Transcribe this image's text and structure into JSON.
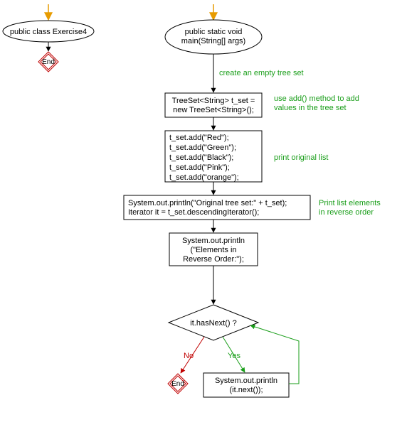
{
  "chart_data": {
    "type": "flowchart",
    "lanes": [
      {
        "name": "class",
        "nodes": [
          {
            "id": "class_entry",
            "type": "entry"
          },
          {
            "id": "class_ellipse",
            "type": "terminator",
            "text": "public class Exercise4"
          },
          {
            "id": "class_end",
            "type": "end",
            "text": "End"
          }
        ],
        "edges": [
          {
            "from": "class_entry",
            "to": "class_ellipse"
          },
          {
            "from": "class_ellipse",
            "to": "class_end"
          }
        ]
      },
      {
        "name": "main",
        "nodes": [
          {
            "id": "main_entry",
            "type": "entry"
          },
          {
            "id": "main_ellipse",
            "type": "terminator",
            "text_lines": [
              "public static void",
              "main(String[] args)"
            ]
          },
          {
            "id": "c1",
            "type": "comment",
            "text": "create an empty tree set"
          },
          {
            "id": "b1",
            "type": "process",
            "text_lines": [
              "TreeSet<String> t_set =",
              "new TreeSet<String>();"
            ]
          },
          {
            "id": "c2",
            "type": "comment",
            "text_lines": [
              "use add() method to add",
              "values in the tree set"
            ]
          },
          {
            "id": "b2",
            "type": "process",
            "text_lines": [
              "t_set.add(\"Red\");",
              "t_set.add(\"Green\");",
              "t_set.add(\"Black\");",
              "t_set.add(\"Pink\");",
              "t_set.add(\"orange\");"
            ]
          },
          {
            "id": "c3",
            "type": "comment",
            "text": "print original list"
          },
          {
            "id": "b3",
            "type": "process",
            "text_lines": [
              "System.out.println(\"Original tree set:\" + t_set);",
              "Iterator it = t_set.descendingIterator();"
            ]
          },
          {
            "id": "c4",
            "type": "comment",
            "text_lines": [
              "Print list elements",
              "in reverse order"
            ]
          },
          {
            "id": "b4",
            "type": "process",
            "text_lines": [
              "System.out.println",
              "(\"Elements in",
              "Reverse Order:\");"
            ]
          },
          {
            "id": "d1",
            "type": "decision",
            "text": "it.hasNext() ?"
          },
          {
            "id": "main_end",
            "type": "end",
            "text": "End"
          },
          {
            "id": "b5",
            "type": "process",
            "text_lines": [
              "System.out.println",
              "(it.next());"
            ]
          }
        ],
        "edges": [
          {
            "from": "main_entry",
            "to": "main_ellipse"
          },
          {
            "from": "main_ellipse",
            "to": "b1",
            "via_comment": "c1"
          },
          {
            "from": "b1",
            "to": "b2",
            "side_comment": "c2"
          },
          {
            "from": "b2",
            "to": "b3",
            "side_comment": "c3"
          },
          {
            "from": "b3",
            "to": "b4",
            "side_comment": "c4"
          },
          {
            "from": "b4",
            "to": "d1"
          },
          {
            "from": "d1",
            "to": "main_end",
            "label": "No"
          },
          {
            "from": "d1",
            "to": "b5",
            "label": "Yes"
          },
          {
            "from": "b5",
            "to": "d1"
          }
        ]
      }
    ]
  },
  "labels": {
    "class_ellipse": "public class Exercise4",
    "class_end": "End",
    "main_ellipse_l1": "public static void",
    "main_ellipse_l2": "main(String[] args)",
    "c1": "create an empty tree set",
    "b1_l1": "TreeSet<String> t_set =",
    "b1_l2": "new TreeSet<String>();",
    "c2_l1": "use add() method to add",
    "c2_l2": "values in the tree set",
    "b2_l1": "t_set.add(\"Red\");",
    "b2_l2": "t_set.add(\"Green\");",
    "b2_l3": "t_set.add(\"Black\");",
    "b2_l4": "t_set.add(\"Pink\");",
    "b2_l5": "t_set.add(\"orange\");",
    "c3": "print original list",
    "b3_l1": "System.out.println(\"Original tree set:\" + t_set);",
    "b3_l2": "Iterator it = t_set.descendingIterator();",
    "c4_l1": "Print list elements",
    "c4_l2": "in reverse order",
    "b4_l1": "System.out.println",
    "b4_l2": "(\"Elements in",
    "b4_l3": "Reverse Order:\");",
    "d1": "it.hasNext() ?",
    "no": "No",
    "yes": "Yes",
    "main_end": "End",
    "b5_l1": "System.out.println",
    "b5_l2": "(it.next());"
  }
}
